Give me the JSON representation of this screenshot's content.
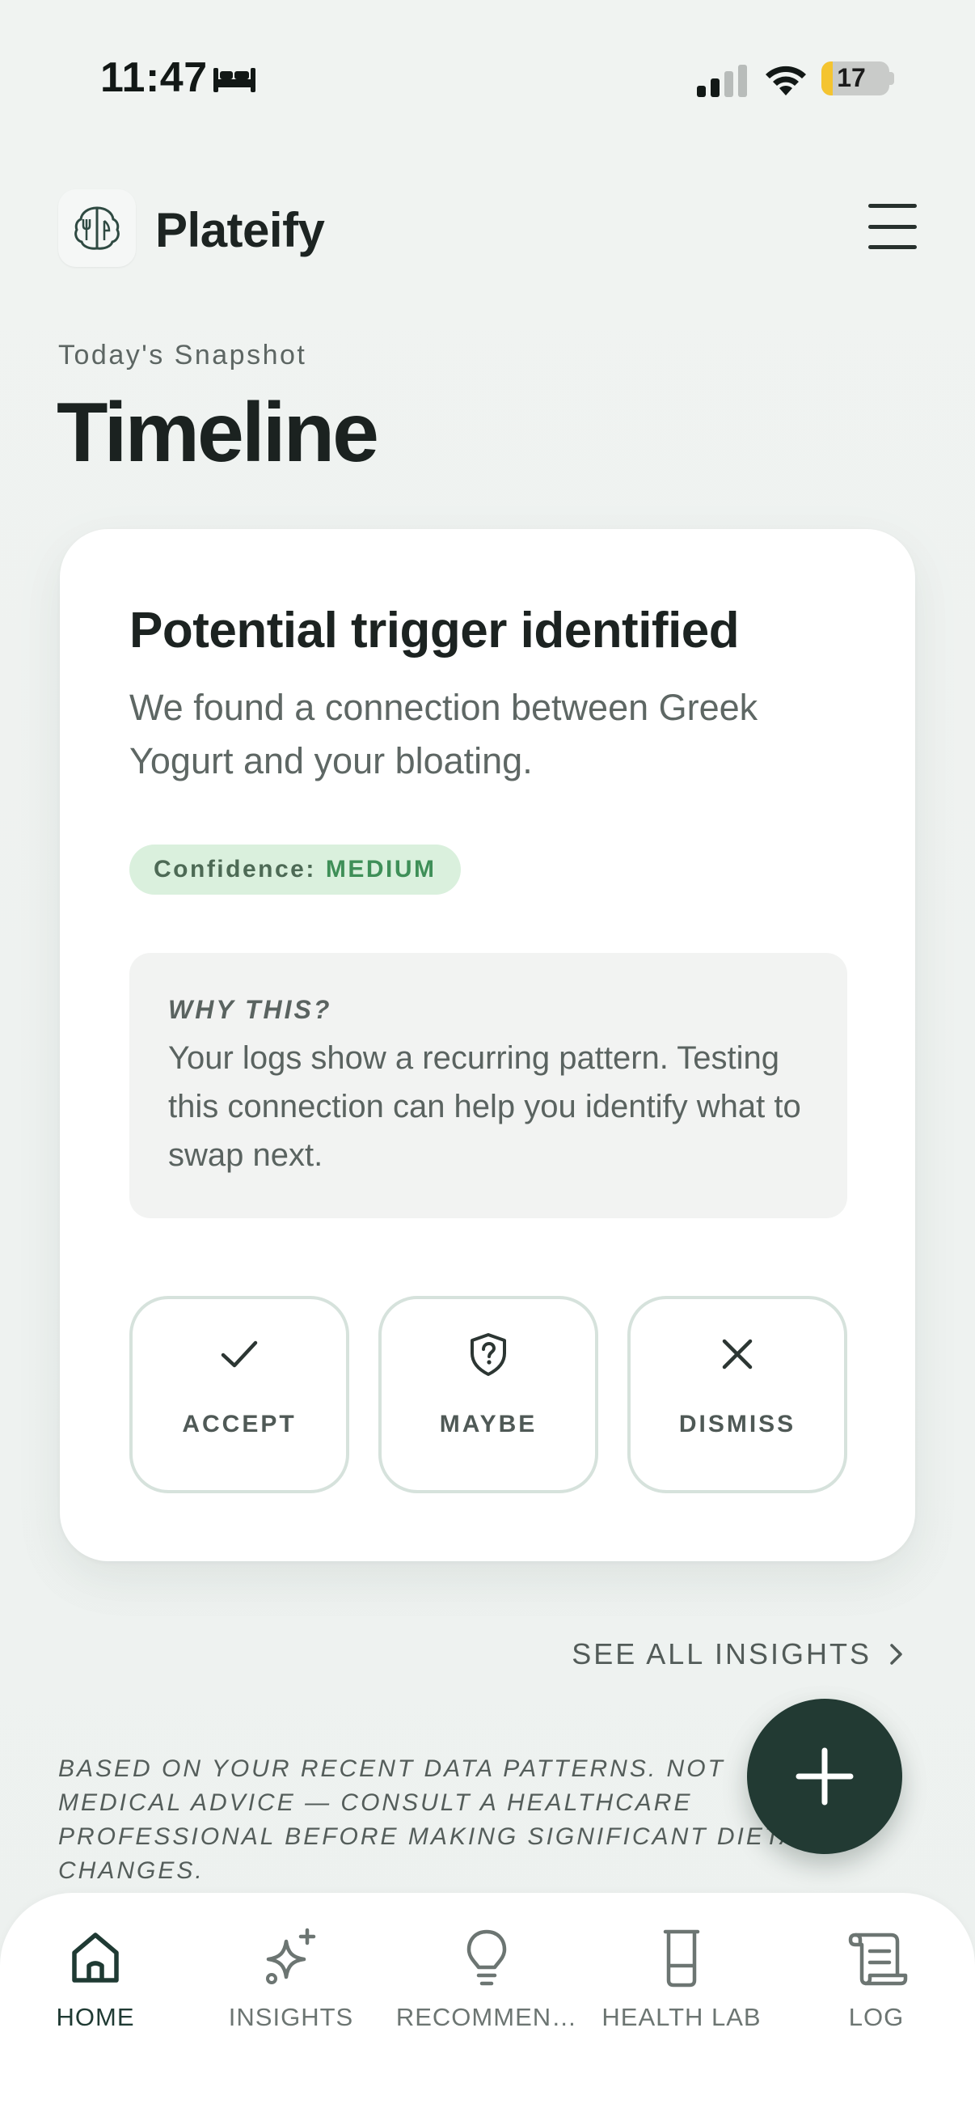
{
  "status_bar": {
    "time": "11:47",
    "battery_level": "17",
    "icons": [
      "bed-icon",
      "cellular-signal-icon",
      "wifi-icon",
      "battery-icon"
    ]
  },
  "header": {
    "app_name": "Plateify",
    "logo_icon": "brain-fork-icon",
    "menu_icon": "hamburger-menu-icon"
  },
  "page": {
    "eyebrow": "Today's Snapshot",
    "title": "Timeline"
  },
  "insight_card": {
    "title": "Potential trigger identified",
    "description": "We found a connection between Greek Yogurt and your bloating.",
    "confidence_label": "Confidence:",
    "confidence_value": "MEDIUM",
    "why_heading": "WHY THIS?",
    "why_text": "Your logs show a recurring pattern. Testing this connection can help you identify what to swap next.",
    "actions": [
      {
        "label": "ACCEPT",
        "icon": "checkmark-icon"
      },
      {
        "label": "MAYBE",
        "icon": "shield-question-icon"
      },
      {
        "label": "DISMISS",
        "icon": "close-icon"
      }
    ]
  },
  "see_all_label": "SEE ALL INSIGHTS",
  "disclaimer": "BASED ON YOUR RECENT DATA PATTERNS. NOT MEDICAL ADVICE — CONSULT A HEALTHCARE PROFESSIONAL BEFORE MAKING SIGNIFICANT DIETARY CHANGES.",
  "fab_icon": "plus-icon",
  "bottom_nav": {
    "items": [
      {
        "label": "HOME",
        "icon": "home-icon",
        "active": true
      },
      {
        "label": "INSIGHTS",
        "icon": "sparkle-icon",
        "active": false
      },
      {
        "label": "RECOMMEN…",
        "icon": "lightbulb-icon",
        "active": false
      },
      {
        "label": "HEALTH LAB",
        "icon": "beaker-icon",
        "active": false
      },
      {
        "label": "LOG",
        "icon": "scroll-icon",
        "active": false
      }
    ]
  },
  "colors": {
    "background": "#eef1ef",
    "accent_dark": "#223a33",
    "confidence_bg": "#daf0dd",
    "confidence_text": "#3f8f58"
  }
}
